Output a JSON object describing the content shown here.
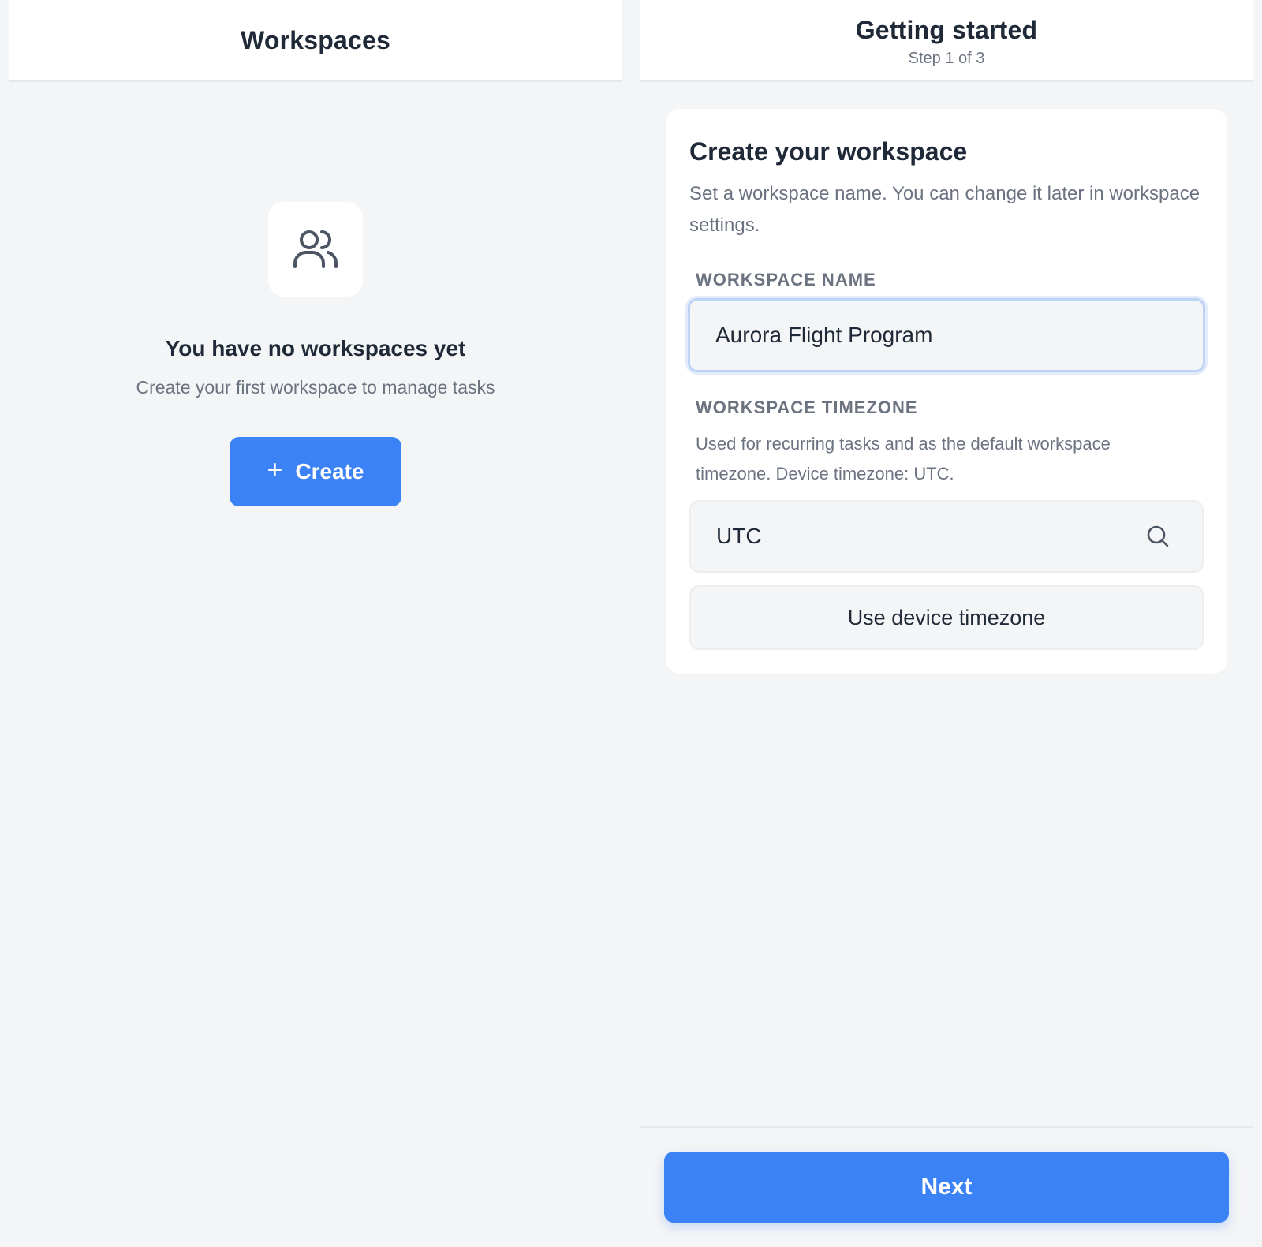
{
  "left_screen": {
    "header_title": "Workspaces",
    "empty_state": {
      "icon": "users-icon",
      "title": "You have no workspaces yet",
      "subtitle": "Create your first workspace to manage tasks",
      "create_label": "Create",
      "create_icon": "plus-icon"
    }
  },
  "right_screen": {
    "header_title": "Getting started",
    "header_subtitle": "Step 1 of 3",
    "card": {
      "title": "Create your workspace",
      "description": "Set a workspace name. You can change it later in workspace settings.",
      "name_label": "WORKSPACE NAME",
      "name_value": "Aurora Flight Program",
      "timezone_label": "WORKSPACE TIMEZONE",
      "timezone_help": "Used for recurring tasks and as the default workspace timezone. Device timezone: UTC.",
      "timezone_value": "UTC",
      "timezone_icon": "search-icon",
      "device_timezone_button": "Use device timezone"
    },
    "next_label": "Next"
  },
  "colors": {
    "accent": "#3b82f6",
    "background": "#f4f5f6",
    "surface": "#ffffff",
    "text_primary": "#1f2937",
    "text_secondary": "#6b7280",
    "focus_ring": "#bcd3f6"
  }
}
